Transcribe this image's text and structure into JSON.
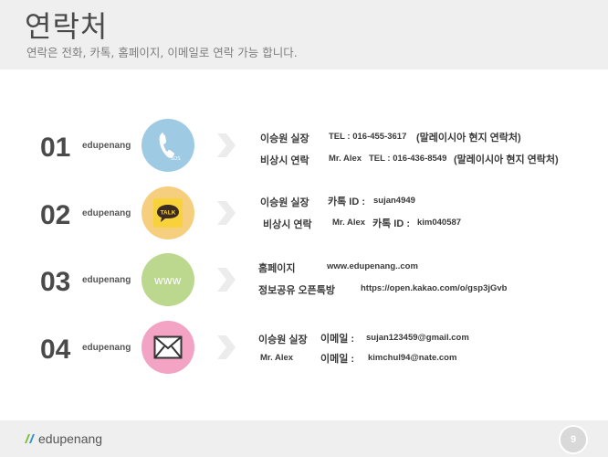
{
  "header": {
    "title": "연락처",
    "subtitle": "연락은 전화, 카톡, 홈페이지, 이메일로 연락 가능 합니다."
  },
  "colors": {
    "phone": "#9ecbe3",
    "talk": "#f6cf7e",
    "www": "#bcd88f",
    "mail": "#f3a3c3",
    "header_bg": "#efefef"
  },
  "rows": [
    {
      "number": "01",
      "brand": "edupenang",
      "icon": "phone-icon",
      "lines": [
        {
          "label": "이승원 실장",
          "name": "",
          "value": "TEL : 016-455-3617",
          "note": "(말레이시아 현지 연락처)"
        },
        {
          "label": "비상시 연락",
          "name": "Mr. Alex",
          "value": "TEL : 016-436-8549",
          "note": "(말레이시아 현지 연락처)"
        }
      ]
    },
    {
      "number": "02",
      "brand": "edupenang",
      "icon": "kakaotalk-icon",
      "icon_text": "TALK",
      "lines": [
        {
          "label": "이승원 실장",
          "name": "",
          "key": "카톡 ID :",
          "value": "sujan4949"
        },
        {
          "label": "비상시 연락",
          "name": "Mr. Alex",
          "key": "카톡 ID :",
          "value": "kim040587"
        }
      ]
    },
    {
      "number": "03",
      "brand": "edupenang",
      "icon": "www-icon",
      "icon_text": "www",
      "lines": [
        {
          "label": "홈페이지",
          "value": "www.edupenang..com"
        },
        {
          "label": "정보공유 오픈톡방",
          "value": "https://open.kakao.com/o/gsp3jGvb"
        }
      ]
    },
    {
      "number": "04",
      "brand": "edupenang",
      "icon": "mail-icon",
      "lines": [
        {
          "label": "이승원 실장",
          "key": "이메일 :",
          "value": "sujan123459@gmail.com"
        },
        {
          "label": "Mr. Alex",
          "key": "이메일 :",
          "value": "kimchul94@nate.com"
        }
      ]
    }
  ],
  "footer": {
    "logo_text": "edupenang",
    "page_number": "9"
  }
}
